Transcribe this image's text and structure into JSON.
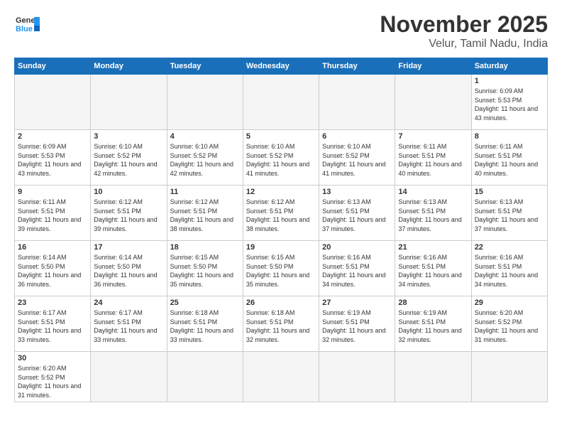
{
  "header": {
    "logo_general": "General",
    "logo_blue": "Blue",
    "title": "November 2025",
    "subtitle": "Velur, Tamil Nadu, India"
  },
  "weekdays": [
    "Sunday",
    "Monday",
    "Tuesday",
    "Wednesday",
    "Thursday",
    "Friday",
    "Saturday"
  ],
  "weeks": [
    [
      {
        "day": "",
        "info": ""
      },
      {
        "day": "",
        "info": ""
      },
      {
        "day": "",
        "info": ""
      },
      {
        "day": "",
        "info": ""
      },
      {
        "day": "",
        "info": ""
      },
      {
        "day": "",
        "info": ""
      },
      {
        "day": "1",
        "info": "Sunrise: 6:09 AM\nSunset: 5:53 PM\nDaylight: 11 hours\nand 43 minutes."
      }
    ],
    [
      {
        "day": "2",
        "info": "Sunrise: 6:09 AM\nSunset: 5:53 PM\nDaylight: 11 hours\nand 43 minutes."
      },
      {
        "day": "3",
        "info": "Sunrise: 6:10 AM\nSunset: 5:52 PM\nDaylight: 11 hours\nand 42 minutes."
      },
      {
        "day": "4",
        "info": "Sunrise: 6:10 AM\nSunset: 5:52 PM\nDaylight: 11 hours\nand 42 minutes."
      },
      {
        "day": "5",
        "info": "Sunrise: 6:10 AM\nSunset: 5:52 PM\nDaylight: 11 hours\nand 41 minutes."
      },
      {
        "day": "6",
        "info": "Sunrise: 6:10 AM\nSunset: 5:52 PM\nDaylight: 11 hours\nand 41 minutes."
      },
      {
        "day": "7",
        "info": "Sunrise: 6:11 AM\nSunset: 5:51 PM\nDaylight: 11 hours\nand 40 minutes."
      },
      {
        "day": "8",
        "info": "Sunrise: 6:11 AM\nSunset: 5:51 PM\nDaylight: 11 hours\nand 40 minutes."
      }
    ],
    [
      {
        "day": "9",
        "info": "Sunrise: 6:11 AM\nSunset: 5:51 PM\nDaylight: 11 hours\nand 39 minutes."
      },
      {
        "day": "10",
        "info": "Sunrise: 6:12 AM\nSunset: 5:51 PM\nDaylight: 11 hours\nand 39 minutes."
      },
      {
        "day": "11",
        "info": "Sunrise: 6:12 AM\nSunset: 5:51 PM\nDaylight: 11 hours\nand 38 minutes."
      },
      {
        "day": "12",
        "info": "Sunrise: 6:12 AM\nSunset: 5:51 PM\nDaylight: 11 hours\nand 38 minutes."
      },
      {
        "day": "13",
        "info": "Sunrise: 6:13 AM\nSunset: 5:51 PM\nDaylight: 11 hours\nand 37 minutes."
      },
      {
        "day": "14",
        "info": "Sunrise: 6:13 AM\nSunset: 5:51 PM\nDaylight: 11 hours\nand 37 minutes."
      },
      {
        "day": "15",
        "info": "Sunrise: 6:13 AM\nSunset: 5:51 PM\nDaylight: 11 hours\nand 37 minutes."
      }
    ],
    [
      {
        "day": "16",
        "info": "Sunrise: 6:14 AM\nSunset: 5:50 PM\nDaylight: 11 hours\nand 36 minutes."
      },
      {
        "day": "17",
        "info": "Sunrise: 6:14 AM\nSunset: 5:50 PM\nDaylight: 11 hours\nand 36 minutes."
      },
      {
        "day": "18",
        "info": "Sunrise: 6:15 AM\nSunset: 5:50 PM\nDaylight: 11 hours\nand 35 minutes."
      },
      {
        "day": "19",
        "info": "Sunrise: 6:15 AM\nSunset: 5:50 PM\nDaylight: 11 hours\nand 35 minutes."
      },
      {
        "day": "20",
        "info": "Sunrise: 6:16 AM\nSunset: 5:51 PM\nDaylight: 11 hours\nand 34 minutes."
      },
      {
        "day": "21",
        "info": "Sunrise: 6:16 AM\nSunset: 5:51 PM\nDaylight: 11 hours\nand 34 minutes."
      },
      {
        "day": "22",
        "info": "Sunrise: 6:16 AM\nSunset: 5:51 PM\nDaylight: 11 hours\nand 34 minutes."
      }
    ],
    [
      {
        "day": "23",
        "info": "Sunrise: 6:17 AM\nSunset: 5:51 PM\nDaylight: 11 hours\nand 33 minutes."
      },
      {
        "day": "24",
        "info": "Sunrise: 6:17 AM\nSunset: 5:51 PM\nDaylight: 11 hours\nand 33 minutes."
      },
      {
        "day": "25",
        "info": "Sunrise: 6:18 AM\nSunset: 5:51 PM\nDaylight: 11 hours\nand 33 minutes."
      },
      {
        "day": "26",
        "info": "Sunrise: 6:18 AM\nSunset: 5:51 PM\nDaylight: 11 hours\nand 32 minutes."
      },
      {
        "day": "27",
        "info": "Sunrise: 6:19 AM\nSunset: 5:51 PM\nDaylight: 11 hours\nand 32 minutes."
      },
      {
        "day": "28",
        "info": "Sunrise: 6:19 AM\nSunset: 5:51 PM\nDaylight: 11 hours\nand 32 minutes."
      },
      {
        "day": "29",
        "info": "Sunrise: 6:20 AM\nSunset: 5:52 PM\nDaylight: 11 hours\nand 31 minutes."
      }
    ],
    [
      {
        "day": "30",
        "info": "Sunrise: 6:20 AM\nSunset: 5:52 PM\nDaylight: 11 hours\nand 31 minutes."
      },
      {
        "day": "",
        "info": ""
      },
      {
        "day": "",
        "info": ""
      },
      {
        "day": "",
        "info": ""
      },
      {
        "day": "",
        "info": ""
      },
      {
        "day": "",
        "info": ""
      },
      {
        "day": "",
        "info": ""
      }
    ]
  ]
}
